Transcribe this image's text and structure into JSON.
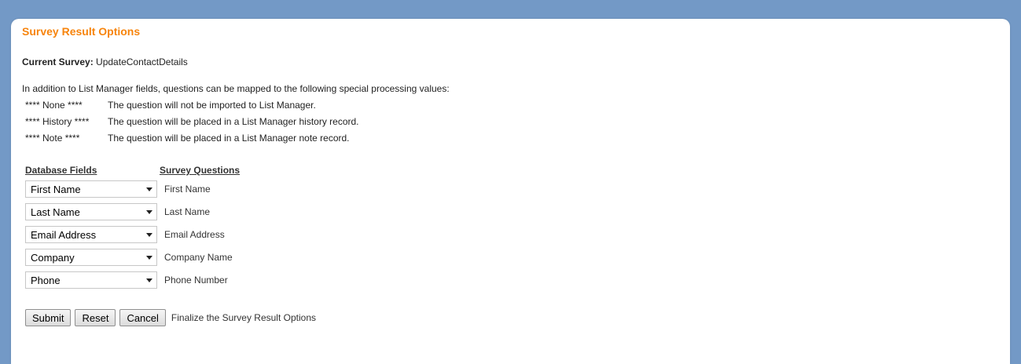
{
  "page": {
    "title": "Survey Result Options",
    "current_survey_label": "Current Survey:",
    "current_survey_value": "UpdateContactDetails",
    "intro_text": "In addition to List Manager fields, questions can be mapped to the following special processing values:"
  },
  "special_values": [
    {
      "code": "**** None ****",
      "description": "The question will not be imported to List Manager."
    },
    {
      "code": "**** History ****",
      "description": "The question will be placed in a List Manager history record."
    },
    {
      "code": "**** Note ****",
      "description": "The question will be placed in a List Manager note record."
    }
  ],
  "mapping": {
    "database_fields_header": "Database Fields",
    "survey_questions_header": "Survey Questions",
    "rows": [
      {
        "field": "First Name",
        "question": "First Name"
      },
      {
        "field": "Last Name",
        "question": "Last Name"
      },
      {
        "field": "Email Address",
        "question": "Email Address"
      },
      {
        "field": "Company",
        "question": "Company Name"
      },
      {
        "field": "Phone",
        "question": "Phone Number"
      }
    ]
  },
  "actions": {
    "submit_label": "Submit",
    "reset_label": "Reset",
    "cancel_label": "Cancel",
    "finalize_text": "Finalize the Survey Result Options"
  },
  "colors": {
    "background": "#7399c6",
    "title": "#f7840c"
  }
}
